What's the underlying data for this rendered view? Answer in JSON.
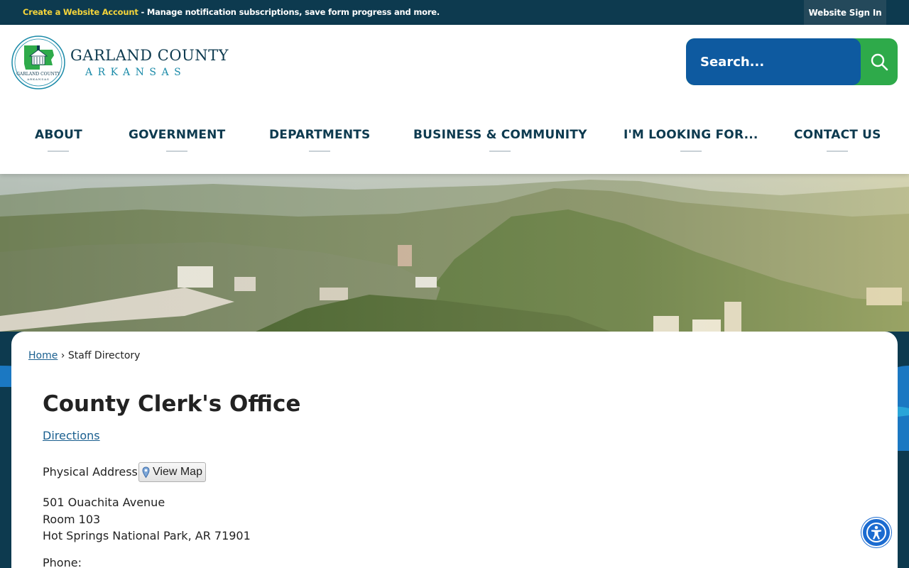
{
  "topbar": {
    "create_account": "Create a Website Account",
    "message": " - Manage notification subscriptions, save form progress and more.",
    "sign_in": "Website Sign In"
  },
  "logo": {
    "title": "GARLAND COUNTY",
    "subtitle": "ARKANSAS",
    "seal_text": "GARLAND COUNTY",
    "seal_subtext": "ARKANSAS"
  },
  "search": {
    "placeholder": "Search..."
  },
  "nav": {
    "items": [
      {
        "label": "ABOUT"
      },
      {
        "label": "GOVERNMENT"
      },
      {
        "label": "DEPARTMENTS"
      },
      {
        "label": "BUSINESS & COMMUNITY"
      },
      {
        "label": "I'M LOOKING FOR..."
      },
      {
        "label": "CONTACT US"
      }
    ]
  },
  "breadcrumb": {
    "home": "Home",
    "separator": "›",
    "current": "Staff Directory"
  },
  "office": {
    "title": "County Clerk's Office",
    "directions": "Directions",
    "physical_address_label": "Physical Address:",
    "view_map": "View Map",
    "address": [
      "501 Ouachita Avenue",
      "Room 103",
      "Hot Springs National Park, AR 71901"
    ],
    "phone_label": "Phone:"
  },
  "colors": {
    "topbar_bg": "#0d3a4f",
    "create_account": "#f4d43a",
    "search_bg": "#0e5aa0",
    "search_button": "#2eaa4a",
    "nav_text": "#0d3a4f",
    "link": "#1a5f8f",
    "accessibility": "#1b6bd0"
  },
  "icons": {
    "search": "search-icon",
    "map_pin": "map-pin-icon",
    "accessibility": "accessibility-icon"
  }
}
